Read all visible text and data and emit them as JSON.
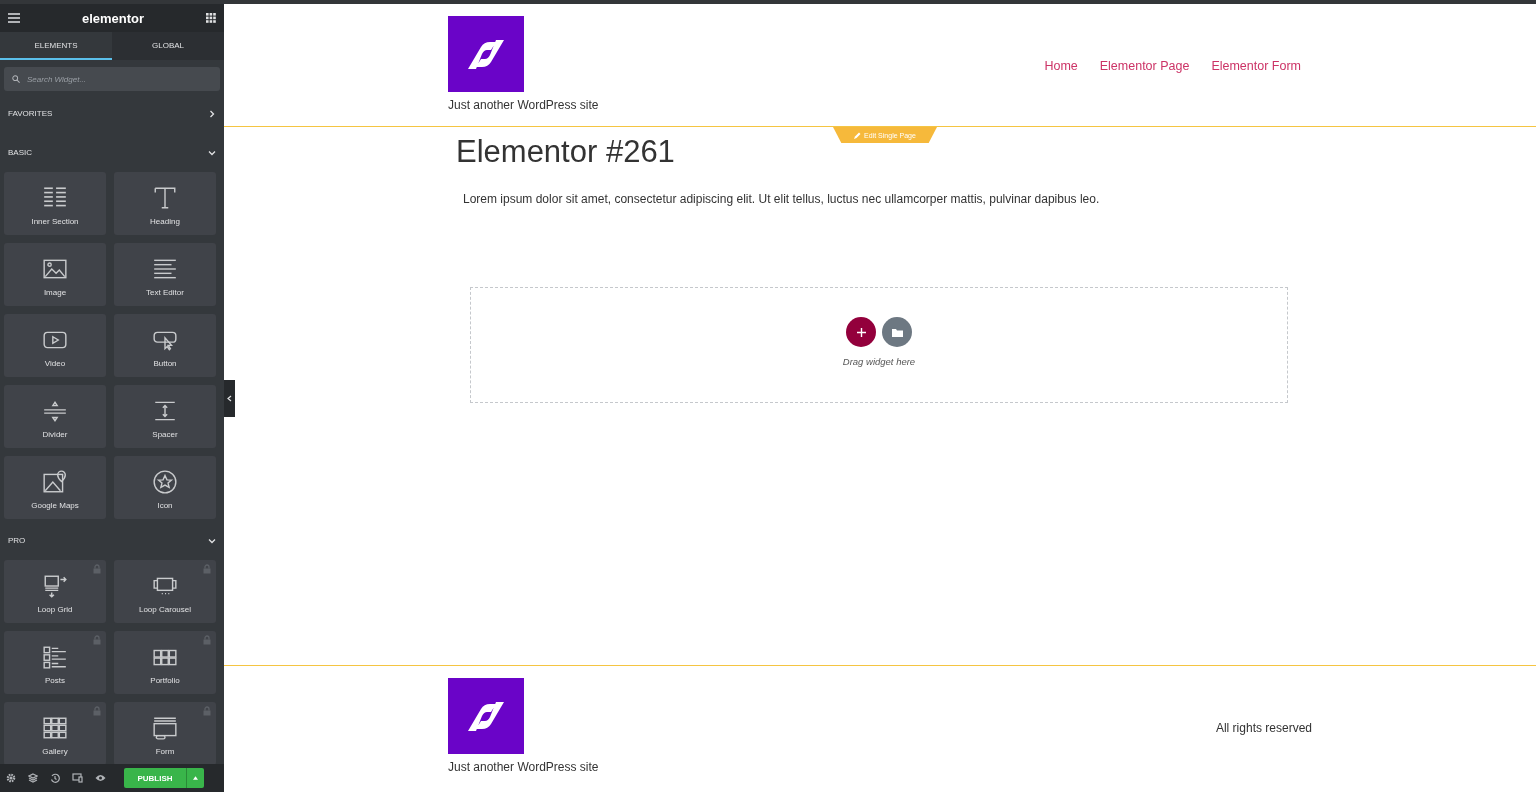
{
  "panel": {
    "logo": "elementor",
    "tabs": [
      {
        "label": "ELEMENTS",
        "selected": true
      },
      {
        "label": "GLOBAL",
        "selected": false
      }
    ],
    "search": {
      "placeholder": "Search Widget..."
    },
    "categories": [
      {
        "title": "FAVORITES",
        "expanded": false
      },
      {
        "title": "BASIC",
        "expanded": true,
        "widgets": [
          {
            "label": "Inner Section",
            "kind": "section",
            "locked": false
          },
          {
            "label": "Heading",
            "kind": "heading",
            "locked": false
          },
          {
            "label": "Image",
            "kind": "image",
            "locked": false
          },
          {
            "label": "Text Editor",
            "kind": "text",
            "locked": false
          },
          {
            "label": "Video",
            "kind": "video",
            "locked": false
          },
          {
            "label": "Button",
            "kind": "button",
            "locked": false
          },
          {
            "label": "Divider",
            "kind": "divider",
            "locked": false
          },
          {
            "label": "Spacer",
            "kind": "spacer",
            "locked": false
          },
          {
            "label": "Google Maps",
            "kind": "map",
            "locked": false
          },
          {
            "label": "Icon",
            "kind": "star",
            "locked": false
          }
        ]
      },
      {
        "title": "PRO",
        "expanded": true,
        "widgets": [
          {
            "label": "Loop Grid",
            "kind": "loopgrid",
            "locked": true
          },
          {
            "label": "Loop Carousel",
            "kind": "carousel",
            "locked": true
          },
          {
            "label": "Posts",
            "kind": "posts",
            "locked": true
          },
          {
            "label": "Portfolio",
            "kind": "portfolio",
            "locked": true
          },
          {
            "label": "Gallery",
            "kind": "gallery",
            "locked": true
          },
          {
            "label": "Form",
            "kind": "form",
            "locked": true
          }
        ]
      }
    ],
    "publish": "PUBLISH"
  },
  "page": {
    "tagline": "Just another WordPress site",
    "nav": [
      "Home",
      "Elementor Page",
      "Elementor Form"
    ],
    "edit_badge": "Edit Single Page",
    "title": "Elementor #261",
    "paragraph": "Lorem ipsum dolor sit amet, consectetur adipiscing elit. Ut elit tellus, luctus nec ullamcorper mattis, pulvinar dapibus leo.",
    "drop_hint": "Drag widget here",
    "footer": {
      "tagline": "Just another WordPress site",
      "rights": "All rights reserved"
    }
  }
}
